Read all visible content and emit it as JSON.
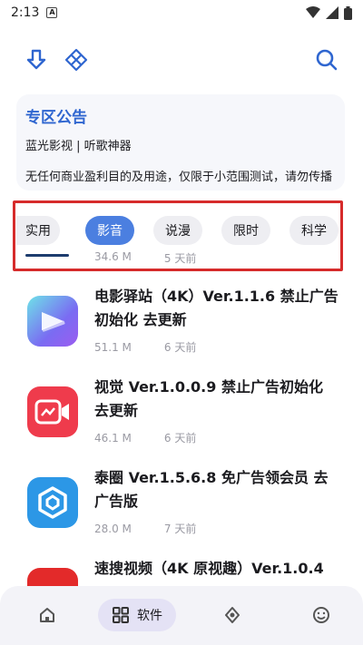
{
  "status_bar": {
    "time": "2:13",
    "notif_letter": "A"
  },
  "notice": {
    "title": "专区公告",
    "subtitle": "蓝光影视 | 听歌神器",
    "text": "无任何商业盈利目的及用途，仅限于小范围测试，请勿传播"
  },
  "tabs": [
    {
      "label": "实用",
      "active": false
    },
    {
      "label": "影音",
      "active": true
    },
    {
      "label": "说漫",
      "active": false
    },
    {
      "label": "限时",
      "active": false
    },
    {
      "label": "科学",
      "active": false
    }
  ],
  "behind_item": {
    "size": "34.6 M",
    "date": "5 天前"
  },
  "apps": [
    {
      "title": "电影驿站（4K）Ver.1.1.6 禁止广告初始化 去更新",
      "size": "51.1 M",
      "date": "6 天前",
      "icon": "film-app-icon"
    },
    {
      "title": "视觉 Ver.1.0.0.9 禁止广告初始化 去更新",
      "size": "46.1 M",
      "date": "6 天前",
      "icon": "video-camera-app-icon"
    },
    {
      "title": "泰圈 Ver.1.5.6.8 免广告领会员 去广告版",
      "size": "28.0 M",
      "date": "7 天前",
      "icon": "hexagon-app-icon"
    },
    {
      "title": "速搜视频（4K 原视趣）Ver.1.0.4",
      "size": "",
      "date": "",
      "icon": "red-app-icon"
    }
  ],
  "bottom_nav": {
    "software_label": "软件"
  },
  "colors": {
    "accent": "#2f66d0",
    "chip_active": "#4b7fe0",
    "highlight": "#d62b2b"
  }
}
